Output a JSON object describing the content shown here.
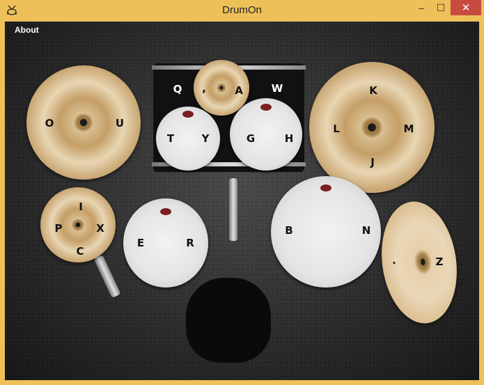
{
  "window": {
    "title": "DrumOn",
    "controls": {
      "minimize": "–",
      "maximize": "☐",
      "close": "✕"
    }
  },
  "menu": {
    "about": "About"
  },
  "colors": {
    "titlebar": "#eec05a",
    "close_button": "#c74b40"
  },
  "keys": {
    "crash_left": [
      "O",
      "U"
    ],
    "tom_kit_top": [
      "Q",
      ",",
      "A",
      "W"
    ],
    "tom_small_left": [
      "T",
      "Y"
    ],
    "tom_small_right": [
      "G",
      "H"
    ],
    "ride_right": [
      "K",
      "L",
      "M",
      "J"
    ],
    "hihat": [
      "I",
      "P",
      "X",
      "C"
    ],
    "floor_tom_left": [
      "E",
      "R"
    ],
    "floor_tom_right": [
      "B",
      "N"
    ],
    "china_right": [
      ".",
      "Z"
    ]
  }
}
